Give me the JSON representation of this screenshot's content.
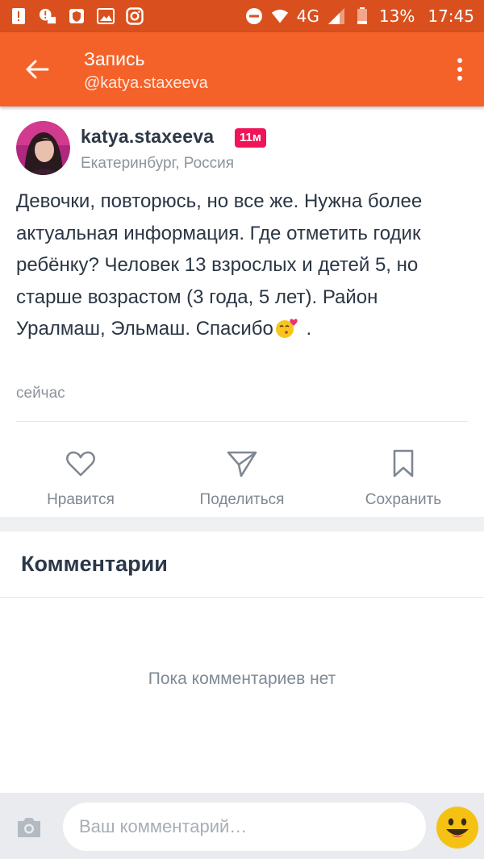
{
  "status_bar": {
    "battery": "13%",
    "time": "17:45",
    "network": "4G"
  },
  "header": {
    "title": "Запись",
    "subtitle": "@katya.staxeeva"
  },
  "post": {
    "author": "katya.staxeeva",
    "badge": "11м",
    "location": "Екатеринбург, Россия",
    "text": "Девочки, повторюсь, но все же. Нужна более актуальная информация. Где отметить годик ребёнку? Человек 13 взрослых и детей 5, но старше возрастом (3 года, 5 лет). Район Уралмаш, Эльмаш. Спасибо",
    "text_suffix": " .",
    "time": "сейчас"
  },
  "actions": {
    "like": "Нравится",
    "share": "Поделиться",
    "save": "Сохранить"
  },
  "comments": {
    "title": "Комментарии",
    "empty": "Пока комментариев нет"
  },
  "composer": {
    "placeholder": "Ваш комментарий…"
  },
  "colors": {
    "status_bar": "#d9501e",
    "app_bar": "#f4622a",
    "badge": "#f0145a"
  }
}
